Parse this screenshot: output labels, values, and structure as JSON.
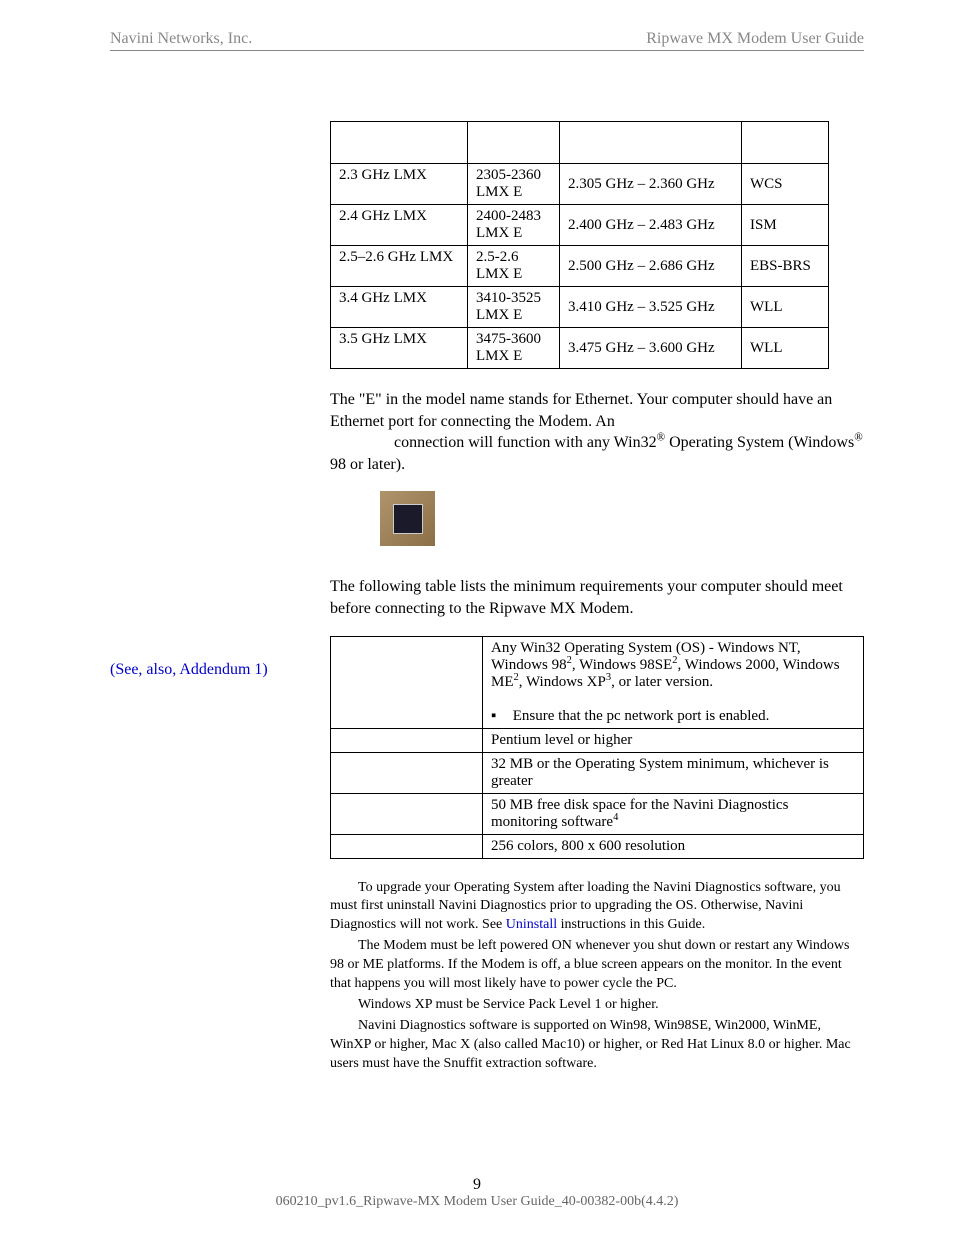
{
  "header": {
    "left": "Navini Networks, Inc.",
    "right": "Ripwave MX Modem User Guide"
  },
  "freq_table": {
    "rows": [
      {
        "name": "2.3 GHz LMX",
        "model_a": "2305-2360",
        "model_b": "LMX E",
        "range": "2.305 GHz – 2.360 GHz",
        "band": "WCS"
      },
      {
        "name": "2.4 GHz LMX",
        "model_a": "2400-2483",
        "model_b": "LMX E",
        "range": "2.400 GHz – 2.483 GHz",
        "band": "ISM"
      },
      {
        "name": "2.5–2.6 GHz LMX",
        "model_a": "2.5-2.6",
        "model_b": "LMX E",
        "range": "2.500 GHz – 2.686 GHz",
        "band": "EBS-BRS"
      },
      {
        "name": "3.4 GHz LMX",
        "model_a": "3410-3525",
        "model_b": "LMX E",
        "range": "3.410 GHz – 3.525 GHz",
        "band": "WLL"
      },
      {
        "name": "3.5 GHz LMX",
        "model_a": "3475-3600",
        "model_b": "LMX E",
        "range": "3.475 GHz – 3.600 GHz",
        "band": "WLL"
      }
    ]
  },
  "para1": {
    "p1a": "The \"E\" in the model name stands for Ethernet. Your computer should have an Ethernet port for connecting the Modem. An",
    "p1b": "connection will function with any Win32",
    "p1c": " Operating System (Windows",
    "p1d": " 98 or later)."
  },
  "para2": "The following table lists the minimum requirements your computer should meet before connecting to the Ripwave MX Modem.",
  "sidebar_note": "(See, also, Addendum 1)",
  "req_table": {
    "rows": [
      {
        "label": "",
        "line1": "Any Win32 Operating System (OS) - Windows NT, Windows 98",
        "sup1": "2",
        "line2": ", Windows 98SE",
        "sup2": "2",
        "line3": ", Windows 2000, Windows ME",
        "sup3": "2",
        "line4": ", Windows XP",
        "sup4": "3",
        "line5": ", or later version.",
        "bullet": "Ensure that the pc network port is enabled."
      },
      {
        "label": "",
        "value": "Pentium level or higher"
      },
      {
        "label": "",
        "value": "32 MB or the Operating System minimum, whichever is greater"
      },
      {
        "label": "",
        "value_a": "50 MB free disk space for the Navini Diagnostics monitoring software",
        "fn": "4"
      },
      {
        "label": "",
        "value": "256 colors, 800 x 600 resolution"
      }
    ]
  },
  "notes": {
    "n1a": "To upgrade your Operating System after loading the Navini Diagnostics software, you must first uninstall Navini Diagnostics prior to upgrading the OS. Otherwise, Navini Diagnostics will not work. See ",
    "n1_link": "Uninstall",
    "n1b": " instructions in this Guide.",
    "n2": "The Modem must be left powered ON whenever you shut down or restart any Windows 98 or ME platforms. If the Modem is off, a blue screen appears on the monitor. In the event that happens you will most likely have to power cycle the PC.",
    "n3": "Windows XP must be Service Pack Level 1 or higher.",
    "n4": "Navini Diagnostics software is supported on Win98, Win98SE, Win2000, WinME, WinXP or higher, Mac X (also called Mac10) or higher, or Red Hat Linux 8.0 or higher. Mac users must have the Snuffit extraction software."
  },
  "footer": {
    "page": "9",
    "doc_id": "060210_pv1.6_Ripwave-MX Modem User Guide_40-00382-00b(4.4.2)"
  }
}
